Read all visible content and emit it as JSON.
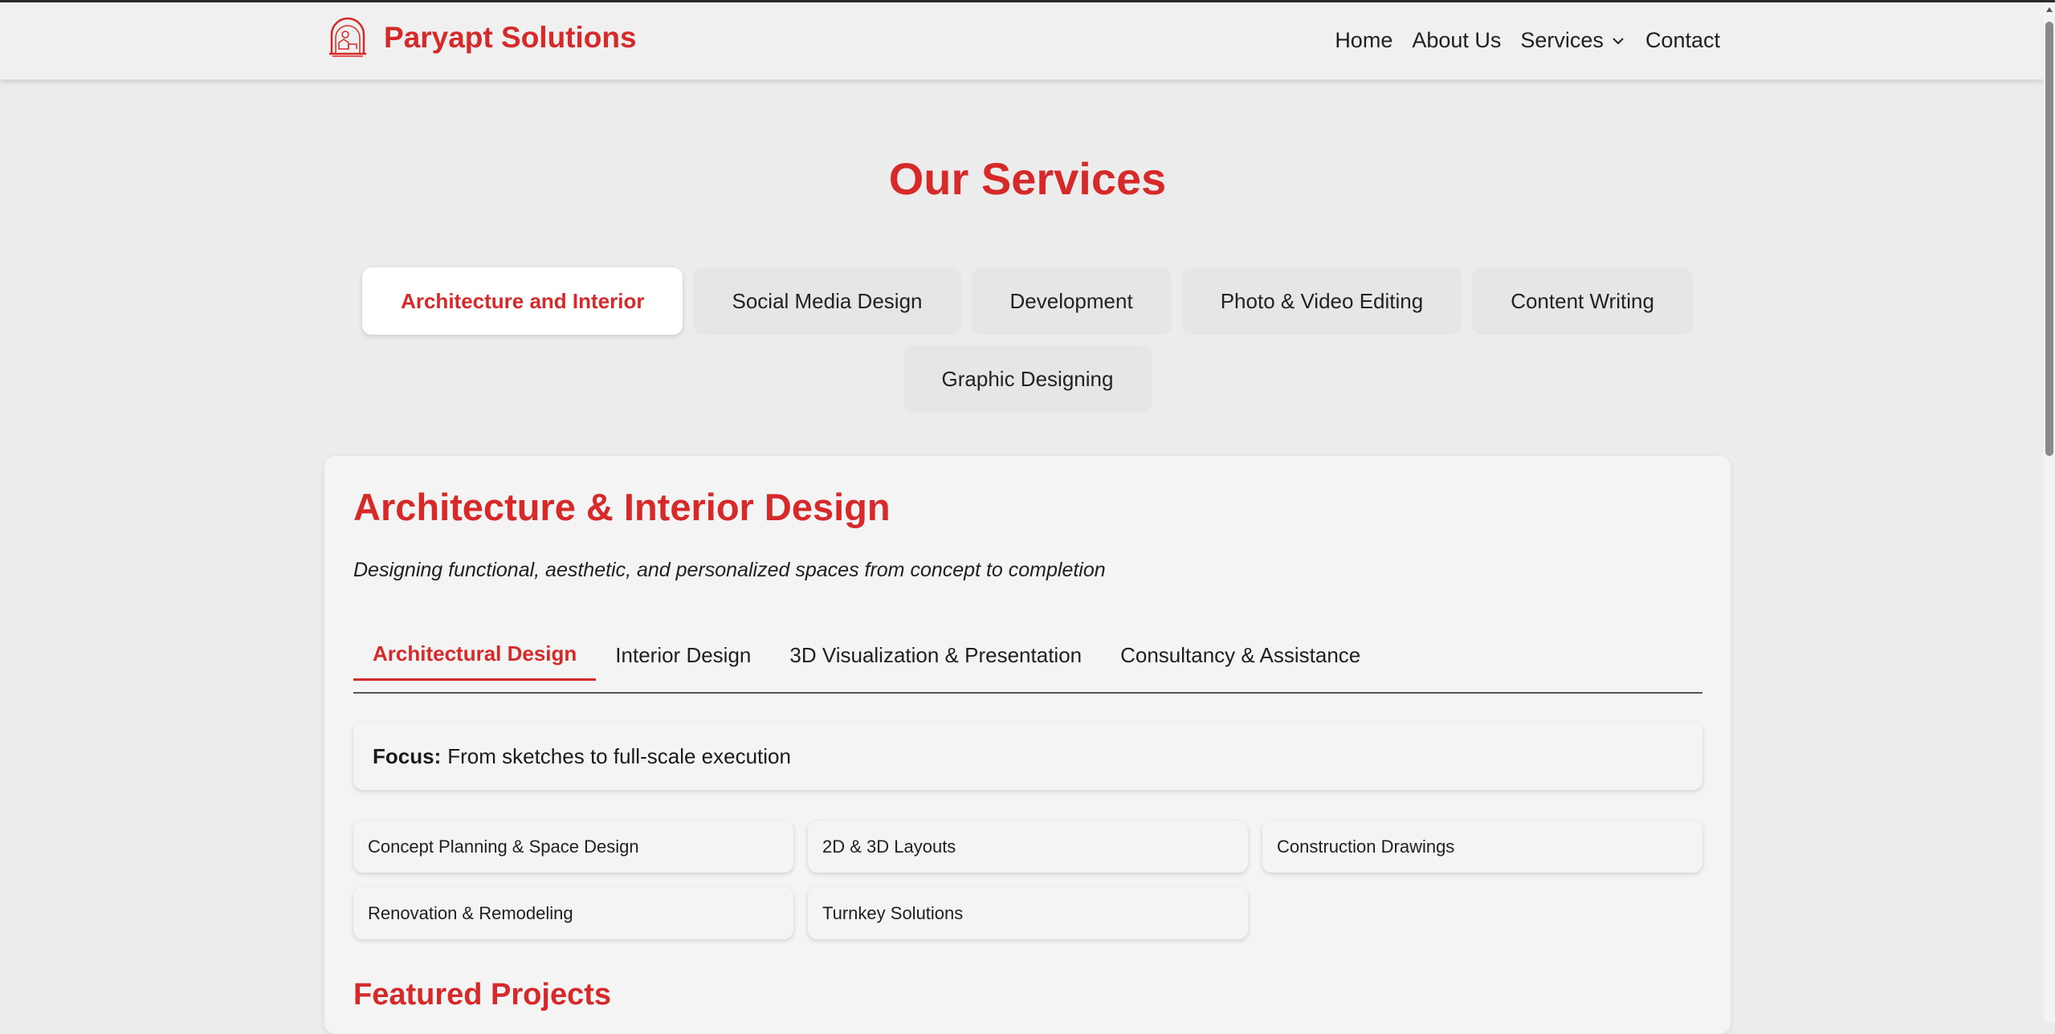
{
  "colors": {
    "accent": "#d62a2a",
    "background": "#ececec",
    "card": "#f4f4f4"
  },
  "header": {
    "logo_icon": "house-arch-logo",
    "brand_name": "Paryapt Solutions",
    "nav": [
      {
        "label": "Home"
      },
      {
        "label": "About Us"
      },
      {
        "label": "Services",
        "icon": "chevron-down-icon"
      },
      {
        "label": "Contact"
      }
    ]
  },
  "main": {
    "title": "Our Services",
    "service_tabs": [
      {
        "label": "Architecture and Interior",
        "active": true
      },
      {
        "label": "Social Media Design"
      },
      {
        "label": "Development"
      },
      {
        "label": "Photo & Video Editing"
      },
      {
        "label": "Content Writing"
      },
      {
        "label": "Graphic Designing"
      }
    ],
    "card": {
      "title": "Architecture & Interior Design",
      "subtitle": "Designing functional, aesthetic, and personalized spaces from concept to completion",
      "sub_tabs": [
        {
          "label": "Architectural Design",
          "active": true
        },
        {
          "label": "Interior Design"
        },
        {
          "label": "3D Visualization & Presentation"
        },
        {
          "label": "Consultancy & Assistance"
        }
      ],
      "focus_label": "Focus:",
      "focus_text": "From sketches to full-scale execution",
      "features": [
        "Concept Planning & Space Design",
        "2D & 3D Layouts",
        "Construction Drawings",
        "Renovation & Remodeling",
        "Turnkey Solutions"
      ],
      "featured_heading": "Featured Projects"
    }
  }
}
